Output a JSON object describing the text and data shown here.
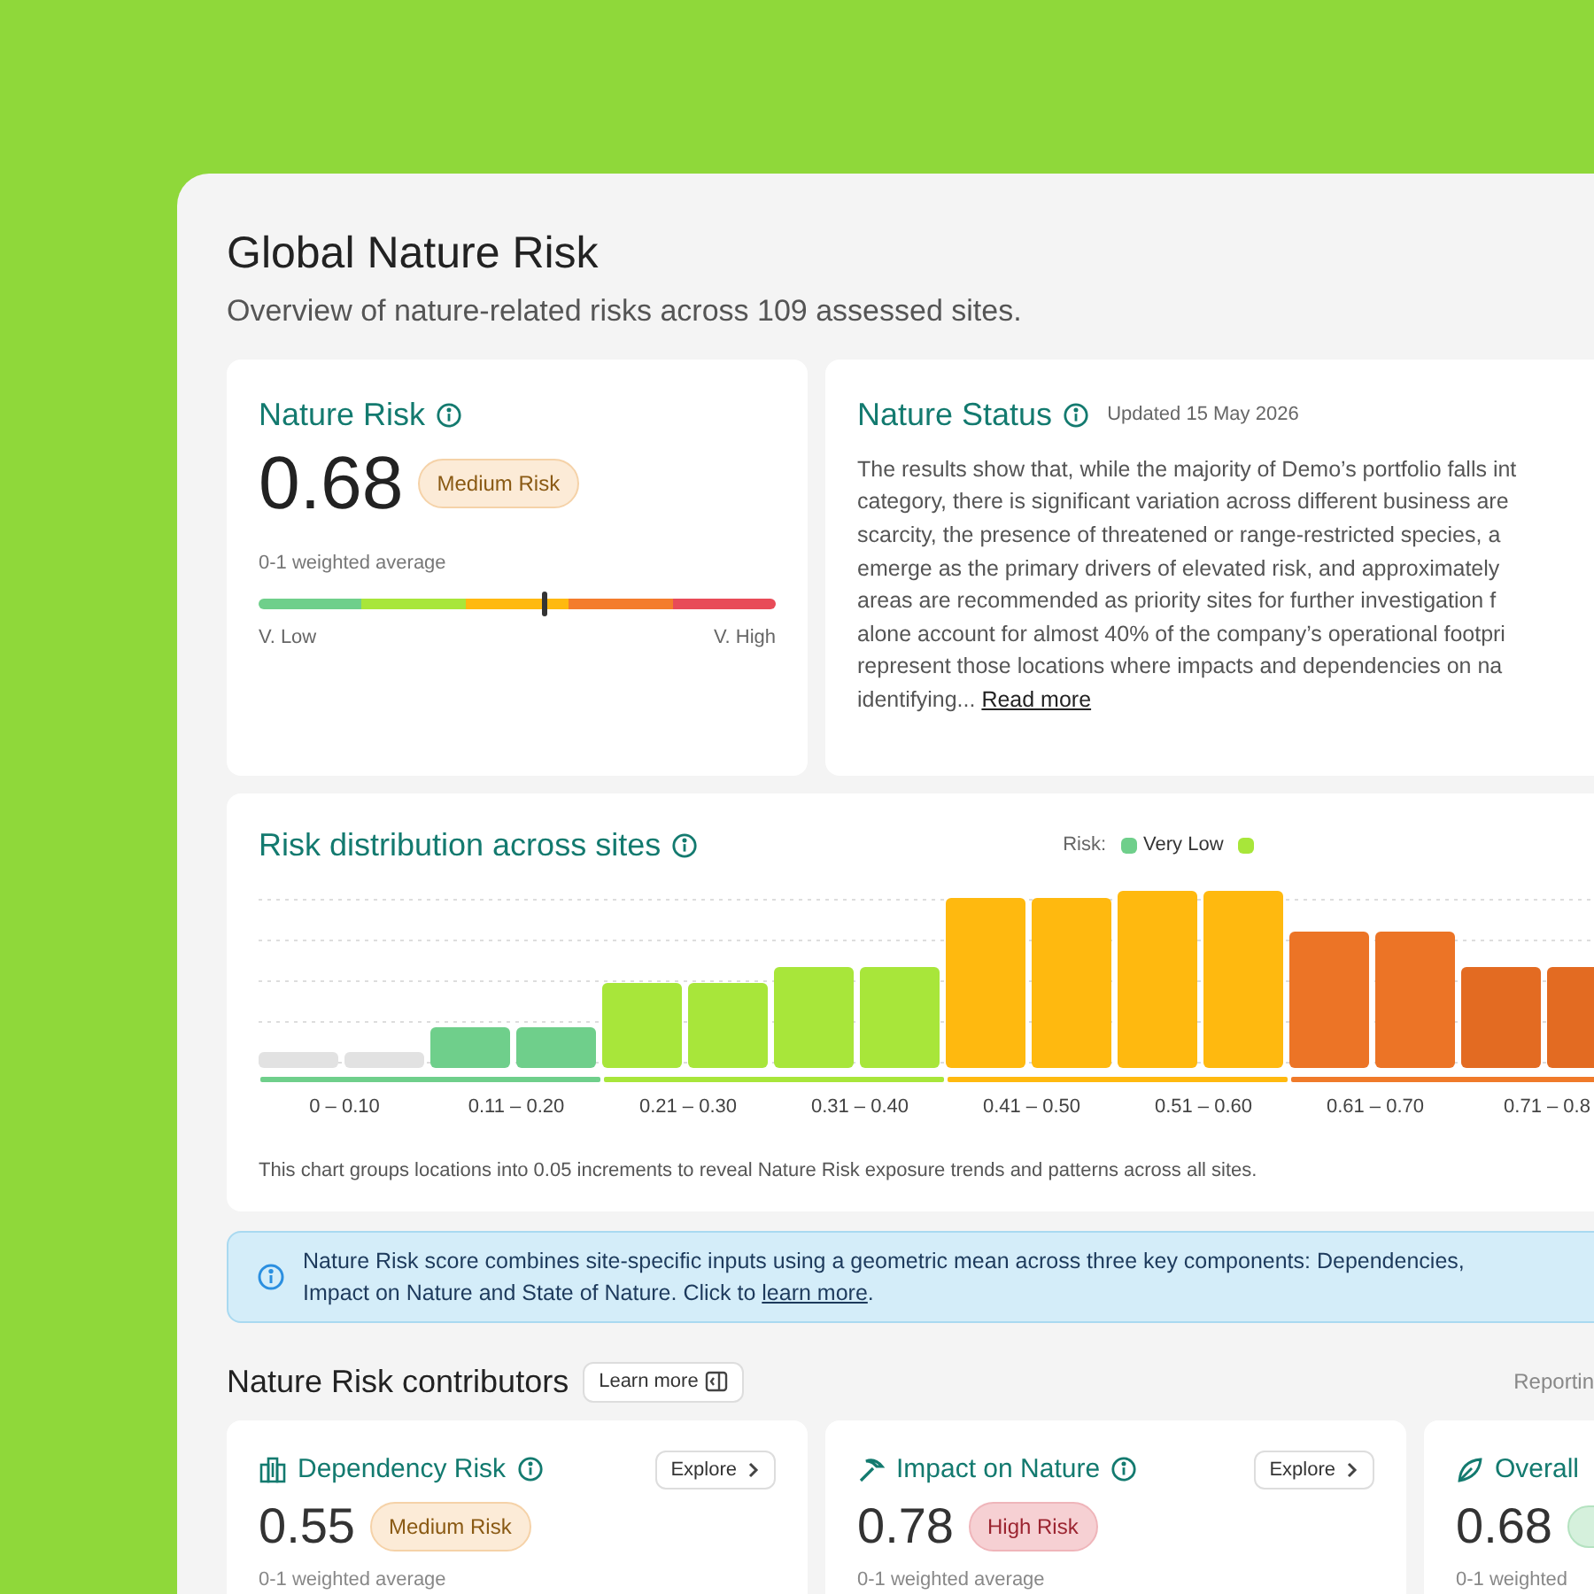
{
  "header": {
    "title": "Global Nature Risk",
    "subtitle": "Overview of nature-related risks across 109 assessed sites."
  },
  "nature_risk": {
    "title": "Nature Risk",
    "score": "0.68",
    "badge": {
      "label": "Medium Risk",
      "kind": "medium"
    },
    "caption": "0-1 weighted average",
    "gauge": {
      "level": 0.55,
      "low_label": "V. Low",
      "high_label": "V. High"
    }
  },
  "nature_status": {
    "title": "Nature Status",
    "updated": "Updated 15 May 2026",
    "lines": [
      "The results show that, while the majority of Demo’s portfolio falls int",
      "category, there is significant variation across different business are",
      "scarcity, the presence of threatened or range-restricted species, a",
      "emerge as the primary drivers of elevated risk, and approximately",
      "areas are recommended as priority sites for further investigation f",
      "alone account for almost 40% of the company’s operational footpri",
      "represent those locations where impacts and dependencies on na",
      "identifying..."
    ],
    "link": "Read more"
  },
  "distribution": {
    "title": "Risk distribution across sites",
    "legend_label": "Risk:",
    "legend": [
      {
        "label": "Very Low",
        "color": "#6fcf8b"
      },
      {
        "color": "#a8e63a"
      }
    ],
    "x_labels": [
      "0 – 0.10",
      "0.11 – 0.20",
      "0.21 – 0.30",
      "0.31 – 0.40",
      "0.41 – 0.50",
      "0.51 – 0.60",
      "0.61 – 0.70",
      "0.71 – 0.8"
    ],
    "note": "This chart groups locations into 0.05 increments to reveal Nature Risk exposure trends and patterns across all sites."
  },
  "info_banner": {
    "text": "Nature Risk score combines site-specific inputs using a geometric mean across three key components: Dependencies, Impact on Nature and State of Nature. Click to",
    "link": "learn more",
    "suffix": "."
  },
  "contributors": {
    "title": "Nature Risk contributors",
    "learn_more": "Learn more",
    "right_label": "Reportin",
    "cards": [
      {
        "kind": "dependency",
        "title": "Dependency Risk",
        "explore": "Explore",
        "score": "0.55",
        "badge": {
          "label": "Medium Risk",
          "kind": "medium"
        },
        "caption": "0-1 weighted average"
      },
      {
        "kind": "impact",
        "title": "Impact on Nature",
        "explore": "Explore",
        "score": "0.78",
        "badge": {
          "label": "High Risk",
          "kind": "high"
        },
        "caption": "0-1 weighted average"
      },
      {
        "kind": "overall",
        "title": "Overall",
        "score": "0.68",
        "badge": {
          "kind": "low"
        },
        "caption": "0-1 weighted"
      }
    ]
  }
}
